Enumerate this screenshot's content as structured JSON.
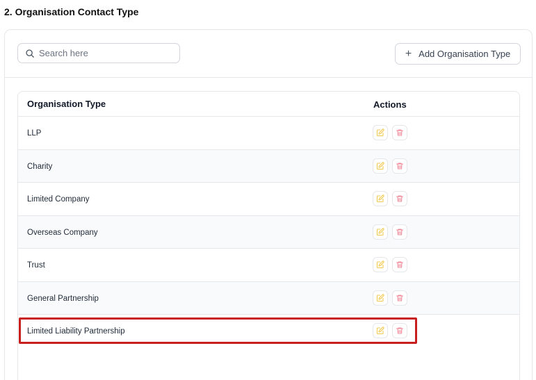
{
  "section": {
    "title": "2. Organisation Contact Type"
  },
  "search": {
    "placeholder": "Search here"
  },
  "toolbar": {
    "add_label": "Add Organisation Type"
  },
  "table": {
    "columns": {
      "type": "Organisation Type",
      "actions": "Actions"
    },
    "rows": [
      {
        "name": "LLP"
      },
      {
        "name": "Charity"
      },
      {
        "name": "Limited Company"
      },
      {
        "name": "Overseas Company"
      },
      {
        "name": "Trust"
      },
      {
        "name": "General Partnership"
      },
      {
        "name": "Limited Liability Partnership"
      }
    ]
  },
  "icons": {
    "search": "search-icon",
    "add": "plus-icon",
    "edit": "edit-icon",
    "delete": "trash-icon"
  },
  "colors": {
    "edit": "#f2c94c",
    "delete": "#f28b9a",
    "highlight": "#c81e1e"
  }
}
